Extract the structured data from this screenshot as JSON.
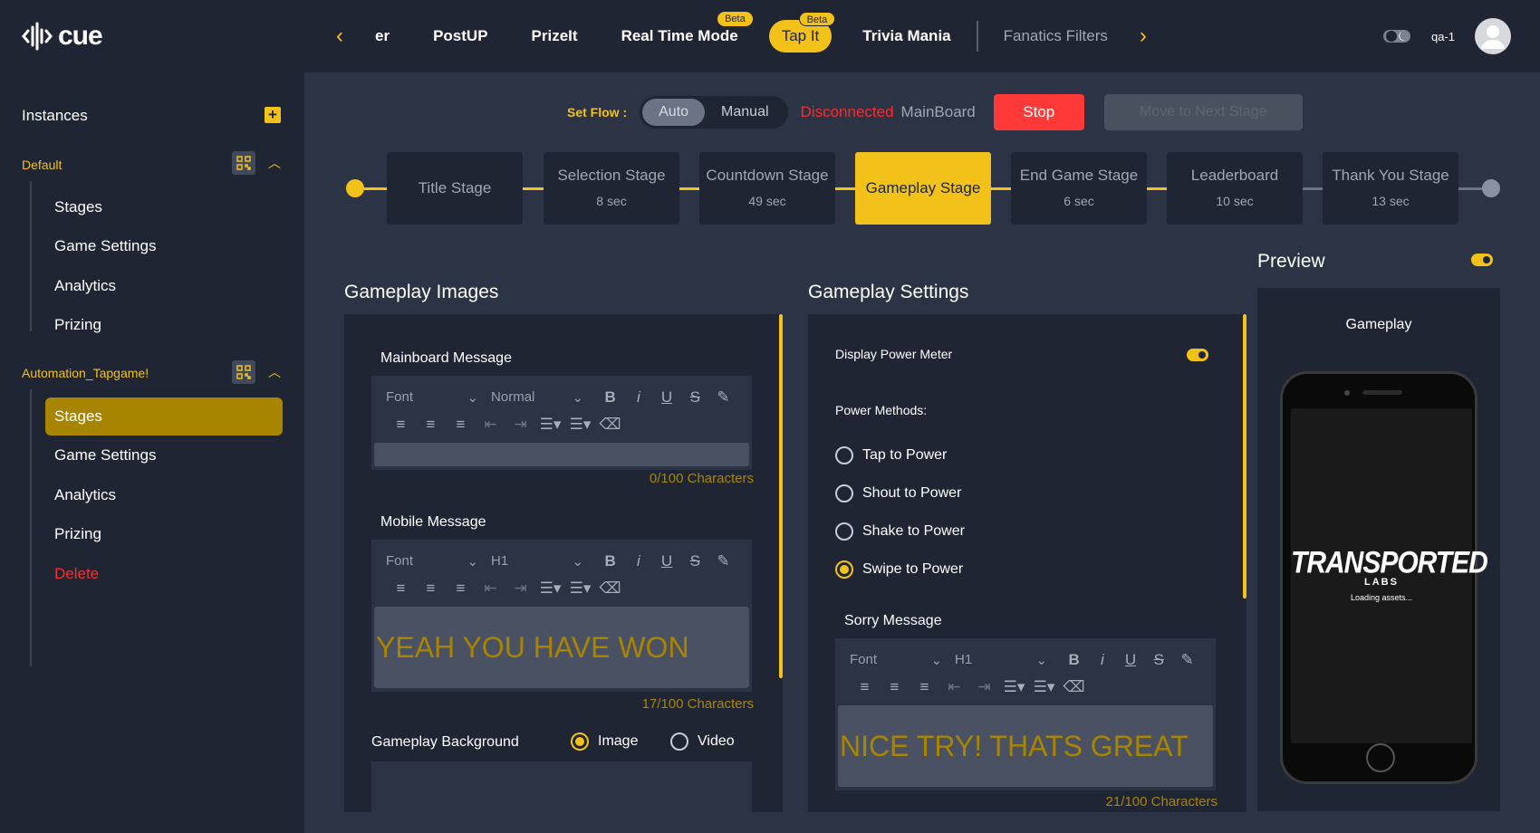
{
  "app": {
    "logo_text": "cue"
  },
  "top_tabs": [
    {
      "label": "er"
    },
    {
      "label": "PostUP"
    },
    {
      "label": "PrizeIt"
    },
    {
      "label": "Real Time Mode",
      "badge": "Beta"
    },
    {
      "label": "Tap It",
      "badge": "Beta",
      "active": true
    },
    {
      "label": "Trivia Mania"
    },
    {
      "label": "Fanatics Filters"
    }
  ],
  "user": {
    "name": "qa-1"
  },
  "sidebar": {
    "heading": "Instances",
    "groups": [
      {
        "name": "Default",
        "items": [
          "Stages",
          "Game Settings",
          "Analytics",
          "Prizing"
        ]
      },
      {
        "name": "Automation_Tapgame!",
        "items": [
          "Stages",
          "Game Settings",
          "Analytics",
          "Prizing",
          "Delete"
        ],
        "active_item": "Stages"
      }
    ]
  },
  "flow": {
    "label": "Set Flow :",
    "options": [
      "Auto",
      "Manual"
    ],
    "selected": "Auto",
    "status": "Disconnected",
    "board": "MainBoard",
    "stop_label": "Stop",
    "next_label": "Move to Next Stage"
  },
  "stages": [
    {
      "name": "Title Stage",
      "duration": ""
    },
    {
      "name": "Selection Stage",
      "duration": "8 sec"
    },
    {
      "name": "Countdown Stage",
      "duration": "49 sec"
    },
    {
      "name": "Gameplay Stage",
      "duration": "",
      "active": true
    },
    {
      "name": "End Game Stage",
      "duration": "6 sec"
    },
    {
      "name": "Leaderboard",
      "duration": "10 sec"
    },
    {
      "name": "Thank You Stage",
      "duration": "13 sec"
    }
  ],
  "images_panel": {
    "title": "Gameplay Images",
    "mainboard": {
      "label": "Mainboard Message",
      "font": "Font",
      "size": "Normal",
      "text": "",
      "counter": "0/100 Characters"
    },
    "mobile": {
      "label": "Mobile Message",
      "font": "Font",
      "size": "H1",
      "text": "YEAH YOU HAVE WON",
      "counter": "17/100 Characters"
    },
    "background": {
      "label": "Gameplay Background",
      "options": [
        "Image",
        "Video"
      ],
      "selected": "Image"
    }
  },
  "settings_panel": {
    "title": "Gameplay Settings",
    "power_meter_label": "Display Power Meter",
    "power_meter_on": true,
    "methods_label": "Power Methods:",
    "methods": [
      "Tap to Power",
      "Shout to Power",
      "Shake to Power",
      "Swipe to Power"
    ],
    "selected_method": "Swipe to Power",
    "sorry": {
      "label": "Sorry Message",
      "font": "Font",
      "size": "H1",
      "text": "NICE TRY! THATS GREAT",
      "counter": "21/100 Characters"
    }
  },
  "preview": {
    "title": "Preview",
    "enabled": true,
    "screen_title": "Gameplay",
    "brand_line1": "TRANSPORTED",
    "brand_line2": "LABS",
    "loading": "Loading assets..."
  },
  "colors": {
    "accent": "#f2c21b",
    "bg": "#2b3344",
    "panel": "#1f2533",
    "danger": "#ff2a2a"
  }
}
